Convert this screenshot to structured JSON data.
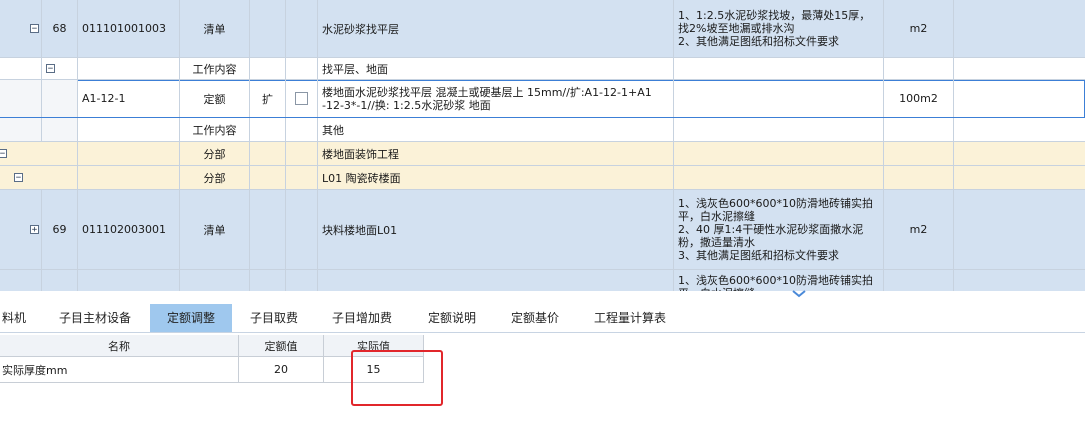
{
  "grid": {
    "rows": [
      {
        "type": "blue",
        "tree": "minus",
        "no": "68",
        "code": "011101001003",
        "kind": "清单",
        "ext": "",
        "name": "水泥砂浆找平层",
        "feature": "1、1:2.5水泥砂浆找坡，最薄处15厚，\n找2%坡至地漏或排水沟\n2、其他满足图纸和招标文件要求",
        "unit": "m2"
      },
      {
        "type": "white",
        "tree": "minus",
        "no": "",
        "code": "",
        "kind": "工作内容",
        "ext": "",
        "name": "找平层、地面",
        "feature": "",
        "unit": ""
      },
      {
        "type": "sel",
        "tree": "",
        "no": "",
        "code": "A1-12-1",
        "kind": "定额",
        "ext": "扩",
        "name": "楼地面水泥砂浆找平层 混凝土或硬基层上 15mm//扩:A1-12-1+A1\n-12-3*-1//换: 1:2.5水泥砂浆 地面",
        "feature": "",
        "unit": "100m2"
      },
      {
        "type": "white",
        "tree": "",
        "no": "",
        "code": "",
        "kind": "工作内容",
        "ext": "",
        "name": "其他",
        "feature": "",
        "unit": ""
      },
      {
        "type": "yellow",
        "tree": "minus",
        "no": "",
        "code": "",
        "kind": "分部",
        "ext": "",
        "name": "楼地面装饰工程",
        "feature": "",
        "unit": ""
      },
      {
        "type": "yellow",
        "tree": "minus",
        "no": "",
        "code": "",
        "kind": "分部",
        "ext": "",
        "name": "L01 陶瓷砖楼面",
        "feature": "",
        "unit": ""
      },
      {
        "type": "blue",
        "tree": "plus",
        "no": "69",
        "code": "011102003001",
        "kind": "清单",
        "ext": "",
        "name": "块料楼地面L01",
        "feature": "1、浅灰色600*600*10防滑地砖铺实拍\n平，白水泥擦缝\n2、40 厚1:4干硬性水泥砂浆面撒水泥\n粉，撒适量清水\n3、其他满足图纸和招标文件要求",
        "unit": "m2"
      },
      {
        "type": "blue",
        "tree": "",
        "no": "",
        "code": "",
        "kind": "",
        "ext": "",
        "name": "",
        "feature": "1、浅灰色600*600*10防滑地砖铺实拍\n平，白水泥擦缝",
        "unit": ""
      }
    ]
  },
  "tabs": {
    "items": [
      "料机",
      "子目主材设备",
      "定额调整",
      "子目取费",
      "子目增加费",
      "定额说明",
      "定额基价",
      "工程量计算表"
    ],
    "active_index": 2
  },
  "param_table": {
    "headers": {
      "name": "名称",
      "quota": "定额值",
      "actual": "实际值"
    },
    "rows": [
      {
        "name": "实际厚度mm",
        "quota": "20",
        "actual": "15"
      }
    ]
  },
  "colors": {
    "accent": "#9fc8ee",
    "highlight_box": "#e1262b",
    "row_blue": "#d3e1f1",
    "row_yellow": "#fbf2d8"
  }
}
